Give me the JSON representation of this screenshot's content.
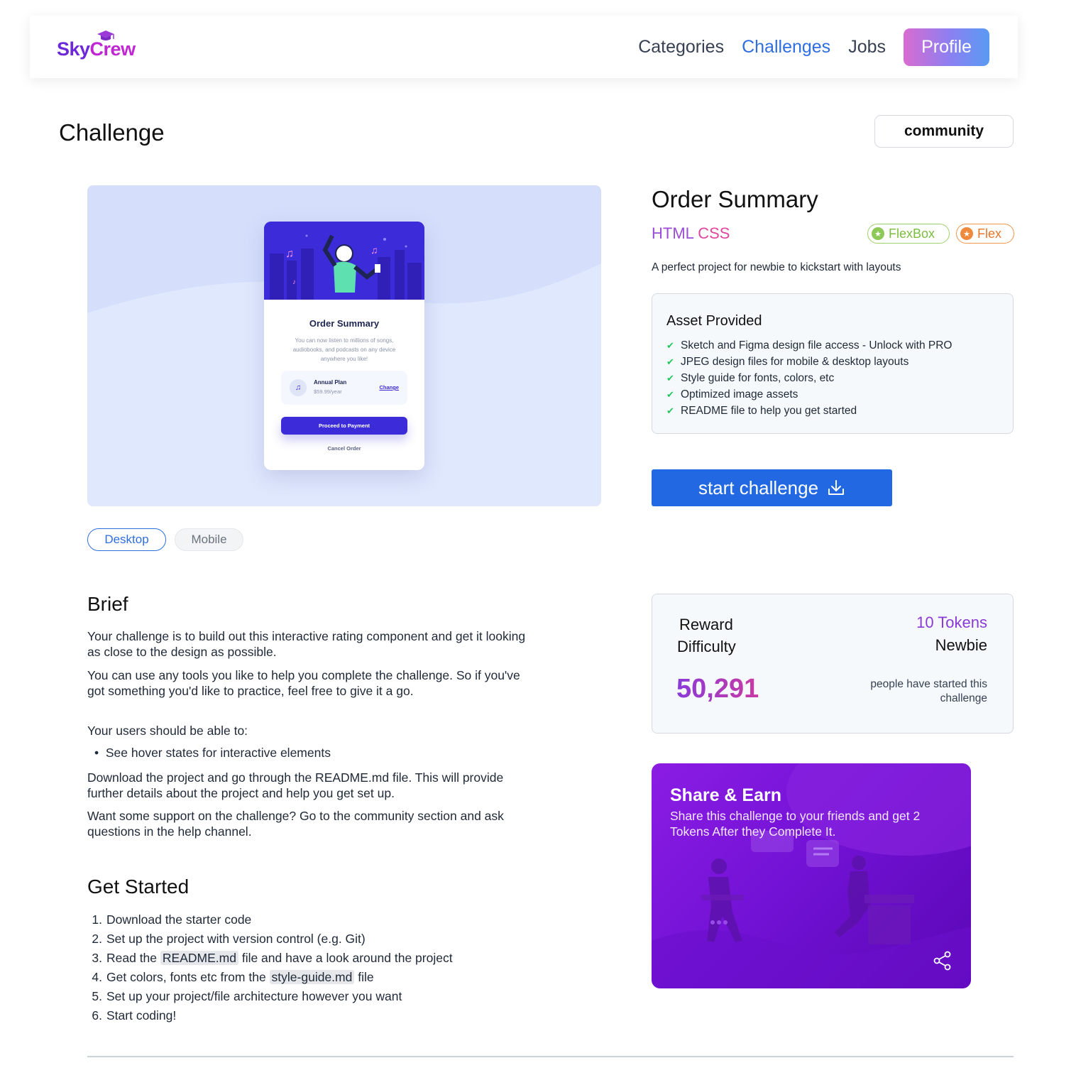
{
  "header": {
    "logo": {
      "part1": "Sky",
      "part2": "Crew",
      "cap_icon": "graduation-cap-icon"
    },
    "nav": {
      "categories": "Categories",
      "challenges": "Challenges",
      "jobs": "Jobs",
      "profile": "Profile"
    },
    "active_nav": "Challenges"
  },
  "page": {
    "title": "Challenge",
    "community_button": "community"
  },
  "preview": {
    "card_title": "Order Summary",
    "card_description": "You can now listen to millions of songs, audiobooks, and podcasts on any device anywhere you like!",
    "plan_name": "Annual Plan",
    "plan_price": "$59.99/year",
    "plan_change": "Change",
    "pay_button": "Proceed to Payment",
    "cancel": "Cancel Order",
    "toggle_desktop": "Desktop",
    "toggle_mobile": "Mobile",
    "selected_view": "Desktop"
  },
  "project": {
    "title": "Order Summary",
    "lang_html": "HTML",
    "lang_css": "CSS",
    "tags": [
      "FlexBox",
      "Flex"
    ],
    "tagline": "A perfect project for newbie to kickstart with layouts",
    "assets_title": "Asset Provided",
    "assets": [
      "Sketch and Figma design file access - Unlock with PRO",
      "JPEG design files for mobile & desktop layouts",
      "Style guide for fonts, colors, etc",
      "Optimized image assets",
      "README file to help you get started"
    ],
    "start_button": "start challenge"
  },
  "brief": {
    "heading": "Brief",
    "p1": "Your challenge is to build out this interactive rating component and get it looking as close to the design as possible.",
    "p2": "You can use any tools you like to help you complete the challenge. So if you've got something you'd like to practice, feel free to give it a go.",
    "p3": "Your users should be able to:",
    "bullet": "See hover states for interactive elements",
    "p4": "Download the project and go through the README.md file. This will provide further details about the project and help you get set up.",
    "p5": "Want some support on the challenge? Go to the community section and ask questions in the help channel."
  },
  "get_started": {
    "heading": "Get Started",
    "step1": "Download the starter code",
    "step2": "Set up the project with version control (e.g. Git)",
    "step3_a": "Read the",
    "step3_code": "README.md",
    "step3_b": "file and have a look around the project",
    "step4_a": "Get colors, fonts etc from the",
    "step4_code": "style-guide.md",
    "step4_b": "file",
    "step5": "Set up your project/file architecture however you want",
    "step6": "Start coding!"
  },
  "reward": {
    "reward_label": "Reward",
    "difficulty_label": "Difficulty",
    "tokens": "10 Tokens",
    "difficulty": "Newbie",
    "count": "50,291",
    "started_text": "people have started this challenge"
  },
  "share": {
    "title": "Share & Earn",
    "text": "Share this challenge to your friends and get 2 Tokens After they Complete It.",
    "icon": "share-icon"
  },
  "colors": {
    "accent_blue": "#2168e2",
    "nav_active": "#2f6ee0",
    "brand_purple": "#8a3ad8",
    "share_bg": "#7312d6"
  }
}
